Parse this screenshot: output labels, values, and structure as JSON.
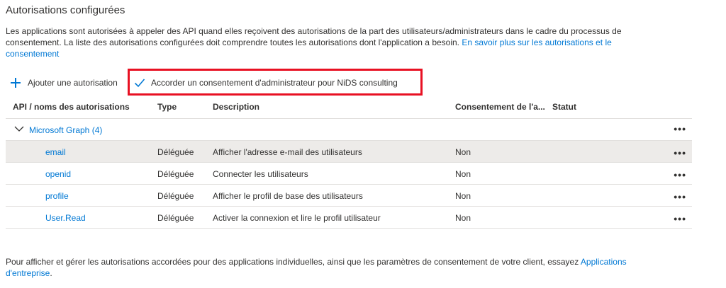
{
  "section": {
    "title": "Autorisations configurées",
    "intro_text": "Les applications sont autorisées à appeler des API quand elles reçoivent des autorisations de la part des utilisateurs/administrateurs dans le cadre du processus de consentement. La liste des autorisations configurées doit comprendre toutes les autorisations dont l'application a besoin. ",
    "intro_link": "En savoir plus sur les autorisations et le consentement"
  },
  "toolbar": {
    "add_permission_label": "Ajouter une autorisation",
    "grant_consent_label": "Accorder un consentement d'administrateur pour NiDS consulting"
  },
  "table": {
    "headers": {
      "api": "API / noms des autorisations",
      "type": "Type",
      "description": "Description",
      "consent": "Consentement de l'a...",
      "status": "Statut"
    },
    "group": {
      "label": "Microsoft Graph (4)",
      "more": "•••"
    },
    "rows": [
      {
        "name": "email",
        "type": "Déléguée",
        "description": "Afficher l'adresse e-mail des utilisateurs",
        "consent": "Non",
        "status": "",
        "more": "•••"
      },
      {
        "name": "openid",
        "type": "Déléguée",
        "description": "Connecter les utilisateurs",
        "consent": "Non",
        "status": "",
        "more": "•••"
      },
      {
        "name": "profile",
        "type": "Déléguée",
        "description": "Afficher le profil de base des utilisateurs",
        "consent": "Non",
        "status": "",
        "more": "•••"
      },
      {
        "name": "User.Read",
        "type": "Déléguée",
        "description": "Activer la connexion et lire le profil utilisateur",
        "consent": "Non",
        "status": "",
        "more": "•••"
      }
    ]
  },
  "footer": {
    "text": "Pour afficher et gérer les autorisations accordées pour des applications individuelles, ainsi que les paramètres de consentement de votre client, essayez ",
    "link": "Applications d'entreprise",
    "suffix": "."
  },
  "colors": {
    "accent": "#0078d4",
    "highlight_border": "#e81123",
    "selected_row": "#edebe9"
  }
}
